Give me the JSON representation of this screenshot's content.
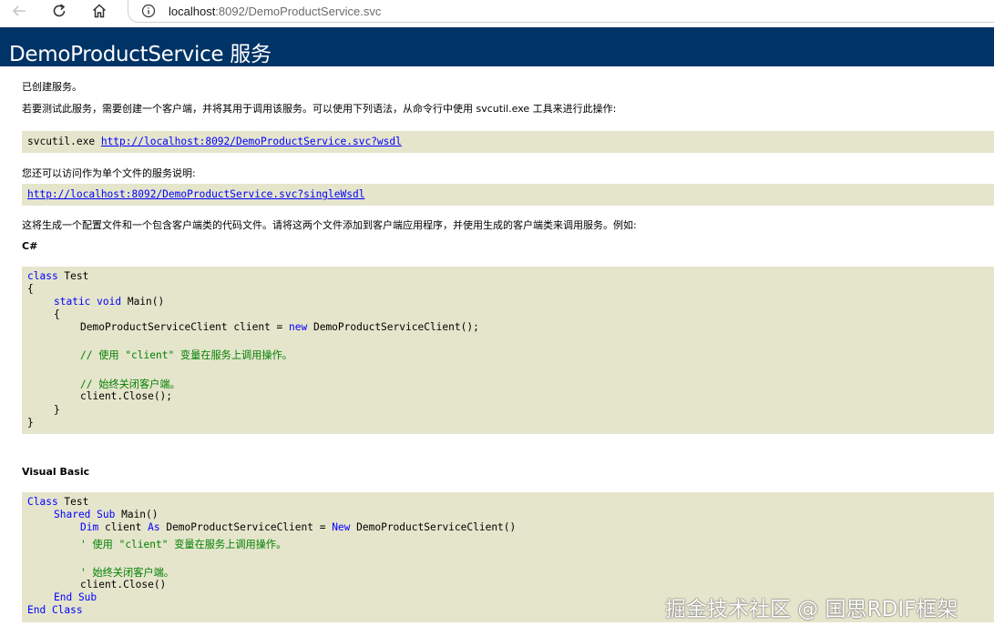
{
  "browser": {
    "url_host": "localhost",
    "url_path": ":8092/DemoProductService.svc"
  },
  "page": {
    "title": "DemoProductService 服务",
    "created_text": "已创建服务。",
    "test_intro": "若要测试此服务，需要创建一个客户端，并将其用于调用该服务。可以使用下列语法，从命令行中使用 svcutil.exe 工具来进行此操作:",
    "svcutil_cmd": "svcutil.exe ",
    "wsdl_link": "http://localhost:8092/DemoProductService.svc?wsdl",
    "single_file_intro": "您还可以访问作为单个文件的服务说明:",
    "single_wsdl_link": "http://localhost:8092/DemoProductService.svc?singleWsdl",
    "generate_text": "这将生成一个配置文件和一个包含客户端类的代码文件。请将这两个文件添加到客户端应用程序，并使用生成的客户端类来调用服务。例如:",
    "csharp_heading": "C#",
    "vb_heading": "Visual Basic"
  },
  "csharp": {
    "l1_kw": "class",
    "l1_rest": " Test",
    "l2": "{",
    "l3_kw": "static void",
    "l3_rest": " Main()",
    "l4": "{",
    "l5_a": "DemoProductServiceClient client = ",
    "l5_kw": "new",
    "l5_b": " DemoProductServiceClient();",
    "l6_comment": "// 使用 \"client\" 变量在服务上调用操作。",
    "l7_comment": "// 始终关闭客户端。",
    "l8": "client.Close();",
    "l9": "}",
    "l10": "}"
  },
  "vb": {
    "l1_kw": "Class",
    "l1_rest": " Test",
    "l2_kw": "Shared Sub",
    "l2_rest": " Main()",
    "l3_kw1": "Dim",
    "l3_a": " client ",
    "l3_kw2": "As",
    "l3_b": " DemoProductServiceClient = ",
    "l3_kw3": "New",
    "l3_c": " DemoProductServiceClient()",
    "l4_comment": "' 使用 \"client\" 变量在服务上调用操作。",
    "l5_comment": "' 始终关闭客户端。",
    "l6": "client.Close()",
    "l7_kw": "End Sub",
    "l8_kw": "End Class"
  },
  "watermark": "掘金技术社区 @ 国思RDIF框架"
}
